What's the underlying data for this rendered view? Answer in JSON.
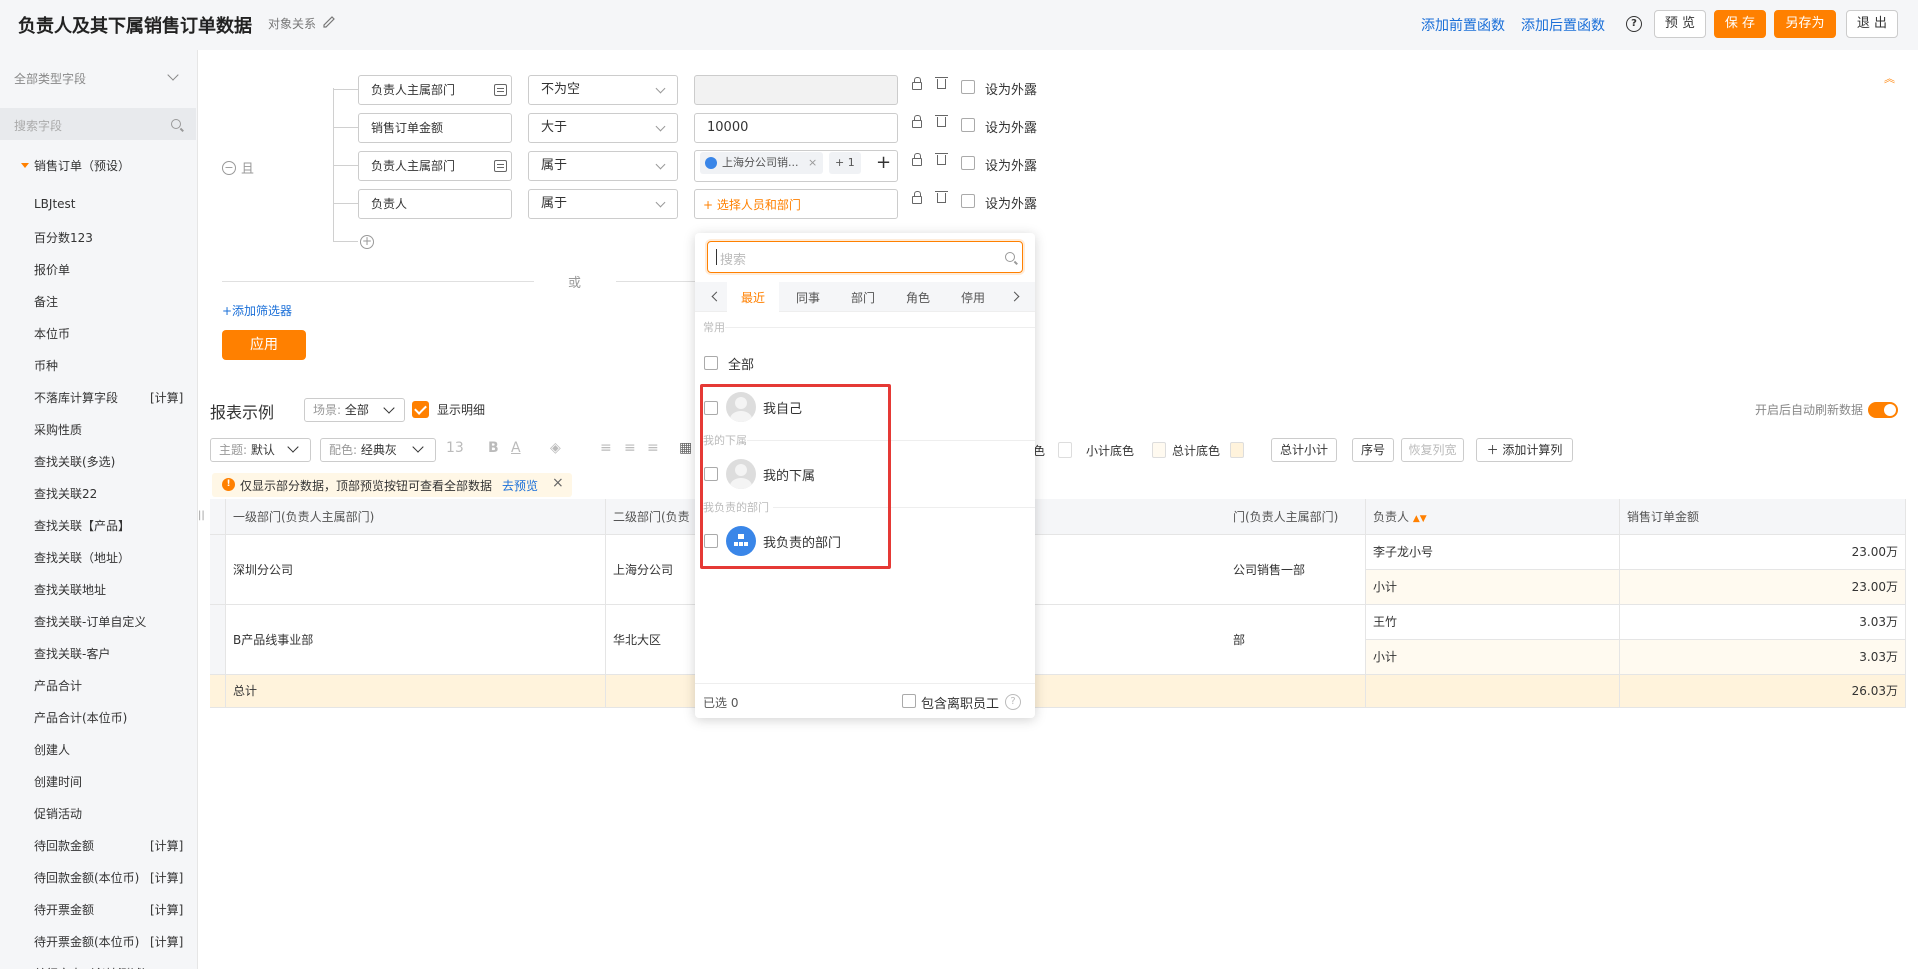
{
  "header": {
    "title": "负责人及其下属销售订单数据",
    "object_relation": "对象关系",
    "add_pre_func": "添加前置函数",
    "add_post_func": "添加后置函数",
    "preview": "预 览",
    "save": "保 存",
    "save_as": "另存为",
    "exit": "退 出"
  },
  "sidebar": {
    "field_type": "全部类型字段",
    "search_placeholder": "搜索字段",
    "root": "销售订单（预设）",
    "items": [
      {
        "label": "LBJtest",
        "tag": ""
      },
      {
        "label": "百分数123",
        "tag": ""
      },
      {
        "label": "报价单",
        "tag": ""
      },
      {
        "label": "备注",
        "tag": ""
      },
      {
        "label": "本位币",
        "tag": ""
      },
      {
        "label": "币种",
        "tag": ""
      },
      {
        "label": "不落库计算字段",
        "tag": "[计算]"
      },
      {
        "label": "采购性质",
        "tag": ""
      },
      {
        "label": "查找关联(多选)",
        "tag": ""
      },
      {
        "label": "查找关联22",
        "tag": ""
      },
      {
        "label": "查找关联【产品】",
        "tag": ""
      },
      {
        "label": "查找关联（地址）",
        "tag": ""
      },
      {
        "label": "查找关联地址",
        "tag": ""
      },
      {
        "label": "查找关联-订单自定义",
        "tag": ""
      },
      {
        "label": "查找关联-客户",
        "tag": ""
      },
      {
        "label": "产品合计",
        "tag": ""
      },
      {
        "label": "产品合计(本位币)",
        "tag": ""
      },
      {
        "label": "创建人",
        "tag": ""
      },
      {
        "label": "创建时间",
        "tag": ""
      },
      {
        "label": "促销活动",
        "tag": ""
      },
      {
        "label": "待回款金额",
        "tag": "[计算]"
      },
      {
        "label": "待回款金额(本位币)",
        "tag": "[计算]"
      },
      {
        "label": "待开票金额",
        "tag": "[计算]"
      },
      {
        "label": "待开票金额(本位币)",
        "tag": "[计算]"
      },
      {
        "label": "单行文本（必填测试）",
        "tag": ""
      }
    ]
  },
  "filters": {
    "and_label": "且",
    "or_label": "或",
    "rows": [
      {
        "field": "负责人主属部门",
        "op": "不为空",
        "value": "",
        "expose": "设为外露"
      },
      {
        "field": "销售订单金额",
        "op": "大于",
        "value": "10000",
        "expose": "设为外露"
      },
      {
        "field": "负责人主属部门",
        "op": "属于",
        "value": "",
        "expose": "设为外露"
      },
      {
        "field": "负责人",
        "op": "属于",
        "value": "",
        "expose": "设为外露"
      }
    ],
    "tag_value": "上海分公司销...",
    "tag_more": "+ 1",
    "select_person": "+ 选择人员和部门",
    "add_filter": "+添加筛选器",
    "apply": "应用"
  },
  "report": {
    "title": "报表示例",
    "scene_label": "场景:",
    "scene_value": "全部",
    "show_detail": "显示明细",
    "auto_refresh": "开启后自动刷新数据",
    "toolbar": {
      "theme_label": "主题:",
      "theme_value": "默认",
      "color_label": "配色:",
      "color_value": "经典灰",
      "font_size": "13",
      "color_frag": "色",
      "subtotal_bg": "小计底色",
      "total_bg": "总计底色",
      "total_subtotal": "总计小计",
      "index": "序号",
      "restore_width": "恢复列宽",
      "add_calc_col": "添加计算列"
    },
    "notice": "仅显示部分数据，顶部预览按钮可查看全部数据",
    "notice_link": "去预览",
    "columns": [
      "一级部门(负责人主属部门)",
      "二级部门(负责",
      "门(负责人主属部门)",
      "负责人",
      "销售订单金额"
    ],
    "rows": [
      {
        "c1": "深圳分公司",
        "c2": "上海分公司",
        "c3": "公司销售一部",
        "person": "李子龙小号",
        "amount": "23.00万",
        "sub_label": "小计",
        "sub_amount": "23.00万"
      },
      {
        "c1": "B产品线事业部",
        "c2": "华北大区",
        "c3": "部",
        "person": "王竹",
        "amount": "3.03万",
        "sub_label": "小计",
        "sub_amount": "3.03万"
      }
    ],
    "total_label": "总计",
    "total_amount": "26.03万"
  },
  "dropdown": {
    "search_placeholder": "搜索",
    "tabs": [
      "最近",
      "同事",
      "部门",
      "角色",
      "停用"
    ],
    "group_common": "常用",
    "all": "全部",
    "myself": "我自己",
    "group_sub": "我的下属",
    "my_subordinates": "我的下属",
    "group_dept": "我负责的部门",
    "my_dept": "我负责的部门",
    "selected": "已选 0",
    "include_resigned": "包含离职员工"
  }
}
